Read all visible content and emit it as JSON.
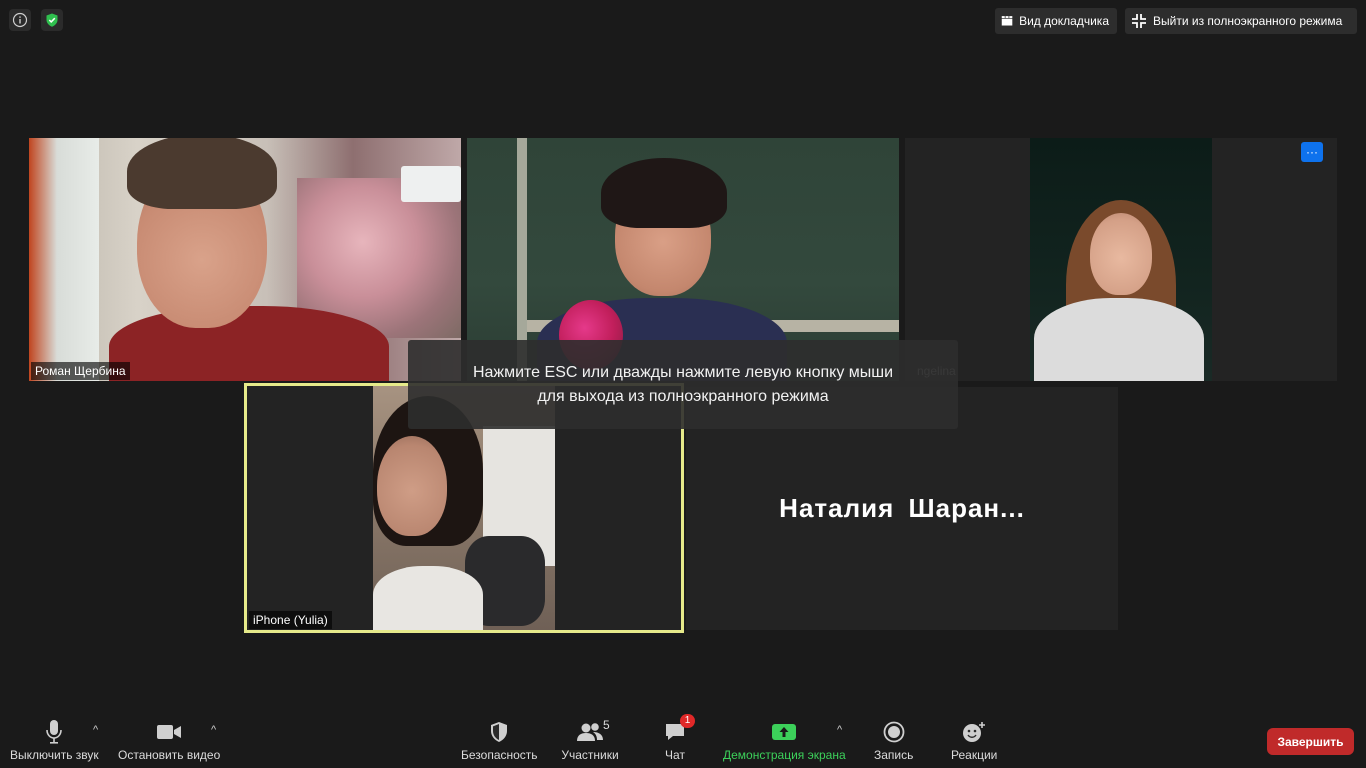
{
  "top_bar": {
    "speaker_view_label": "Вид докладчика",
    "exit_fullscreen_label": "Выйти из полноэкранного режима"
  },
  "participants": [
    {
      "name": "Роман Щербина"
    },
    {
      "name": ""
    },
    {
      "name": "ngelina"
    },
    {
      "name": "iPhone (Yulia)"
    },
    {
      "name": "Наталия  Шаран..."
    }
  ],
  "overlay": {
    "line1": "Нажмите ESC или дважды нажмите левую кнопку мыши",
    "line2": "для выхода из полноэкранного режима"
  },
  "more_label": "···",
  "toolbar": {
    "mute_label": "Выключить звук",
    "video_label": "Остановить видео",
    "security_label": "Безопасность",
    "participants_label": "Участники",
    "participants_count": "5",
    "chat_label": "Чат",
    "chat_badge": "1",
    "share_label": "Демонстрация экрана",
    "record_label": "Запись",
    "reactions_label": "Реакции",
    "end_label": "Завершить",
    "caret": "^"
  },
  "colors": {
    "active_speaker_border": "#e6ea8a",
    "share_green": "#3cd05a",
    "end_red": "#c02a2a",
    "shield_green": "#2fbf4e",
    "more_blue": "#0e72ed"
  }
}
